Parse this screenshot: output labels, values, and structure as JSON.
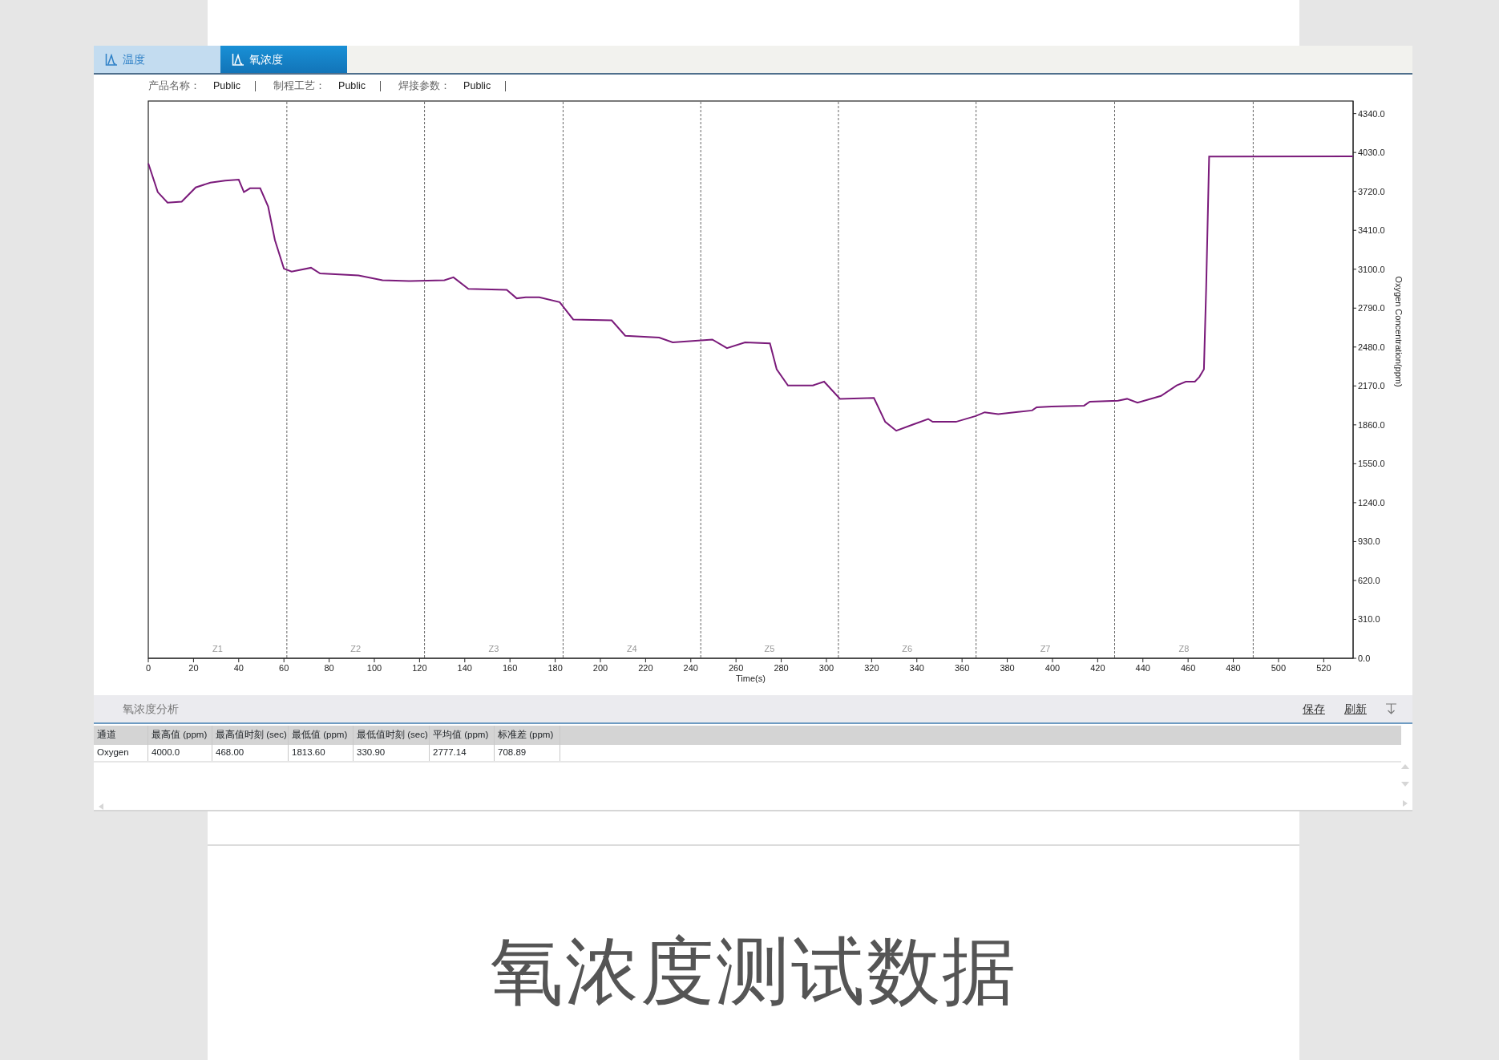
{
  "tabs": [
    {
      "label": "温度",
      "selected": false
    },
    {
      "label": "氧浓度",
      "selected": true
    }
  ],
  "info": [
    {
      "label": "产品名称：",
      "value": "Public"
    },
    {
      "label": "制程工艺：",
      "value": "Public"
    },
    {
      "label": "焊接参数：",
      "value": "Public"
    }
  ],
  "chart": {
    "chart_data": {
      "type": "line",
      "xlabel": "Time(s)",
      "ylabel": "Oxygen Concentration(ppm)",
      "x": [
        0,
        4.2,
        8.5,
        14.8,
        21,
        27.5,
        34,
        40,
        42.3,
        45,
        49.5,
        53,
        56,
        60,
        63.4,
        72,
        76,
        93,
        103.6,
        116,
        131,
        135,
        141.6,
        158.6,
        163,
        167,
        173,
        182,
        188,
        205,
        211,
        226,
        232,
        249.5,
        256,
        264,
        275,
        278,
        283,
        294,
        299,
        306,
        321,
        326,
        330.9,
        338,
        345,
        347,
        357.3,
        366,
        370,
        376,
        391,
        393,
        399.6,
        414,
        416.5,
        429,
        433,
        437.6,
        448,
        455,
        459,
        463,
        465,
        467,
        468,
        469.3,
        533
      ],
      "series": [
        {
          "color": "#7a1a7a",
          "values": [
            3943,
            3714,
            3630,
            3638,
            3752,
            3790,
            3806,
            3813,
            3714,
            3745,
            3745,
            3600,
            3333,
            3104,
            3081,
            3112,
            3066,
            3051,
            3013,
            3005,
            3013,
            3035,
            2944,
            2936,
            2868,
            2876,
            2876,
            2837,
            2700,
            2692,
            2570,
            2555,
            2517,
            2540,
            2471,
            2517,
            2509,
            2303,
            2174,
            2174,
            2204,
            2067,
            2075,
            1884,
            1813,
            1861,
            1907,
            1884,
            1884,
            1930,
            1960,
            1945,
            1975,
            2000,
            2006,
            2013,
            2044,
            2052,
            2067,
            2036,
            2090,
            2174,
            2204,
            2204,
            2242,
            2303,
            2952,
            3997,
            4000
          ]
        }
      ],
      "xlim": [
        0,
        533
      ],
      "ylim": [
        0,
        4440
      ],
      "xticks": [
        0,
        20,
        40,
        60,
        80,
        100,
        120,
        140,
        160,
        180,
        200,
        220,
        240,
        260,
        280,
        300,
        320,
        340,
        360,
        380,
        400,
        420,
        440,
        460,
        480,
        500,
        520
      ],
      "yticks": [
        {
          "value": 0,
          "label": "0.0"
        },
        {
          "value": 310,
          "label": "310.0"
        },
        {
          "value": 620,
          "label": "620.0"
        },
        {
          "value": 930,
          "label": "930.0"
        },
        {
          "value": 1240,
          "label": "1240.0"
        },
        {
          "value": 1550,
          "label": "1550.0"
        },
        {
          "value": 1860,
          "label": "1860.0"
        },
        {
          "value": 2170,
          "label": "2170.0"
        },
        {
          "value": 2480,
          "label": "2480.0"
        },
        {
          "value": 2790,
          "label": "2790.0"
        },
        {
          "value": 3100,
          "label": "3100.0"
        },
        {
          "value": 3410,
          "label": "3410.0"
        },
        {
          "value": 3720,
          "label": "3720.0"
        },
        {
          "value": 4030,
          "label": "4030.0"
        },
        {
          "value": 4340,
          "label": "4340.0"
        }
      ],
      "ref_lines": [
        {
          "axis": "x",
          "value": 61.3
        },
        {
          "axis": "x",
          "value": 122.2
        },
        {
          "axis": "x",
          "value": 183.5
        },
        {
          "axis": "x",
          "value": 244.4
        },
        {
          "axis": "x",
          "value": 305.3
        },
        {
          "axis": "x",
          "value": 366.2
        },
        {
          "axis": "x",
          "value": 427.5
        },
        {
          "axis": "x",
          "value": 488.8
        }
      ],
      "annotations": [
        "Z1",
        "Z2",
        "Z3",
        "Z4",
        "Z5",
        "Z6",
        "Z7",
        "Z8"
      ]
    }
  },
  "analysis": {
    "title": "氧浓度分析",
    "actions": [
      "保存",
      "刷新"
    ],
    "table": {
      "columns": [
        "通道",
        "最高值 (ppm)",
        "最高值时刻 (sec)",
        "最低值 (ppm)",
        "最低值时刻 (sec)",
        "平均值 (ppm)",
        "标准差 (ppm)"
      ],
      "rows": [
        [
          "Oxygen",
          "4000.0",
          "468.00",
          "1813.60",
          "330.90",
          "2777.14",
          "708.89"
        ]
      ]
    }
  },
  "caption": "氧浓度测试数据"
}
